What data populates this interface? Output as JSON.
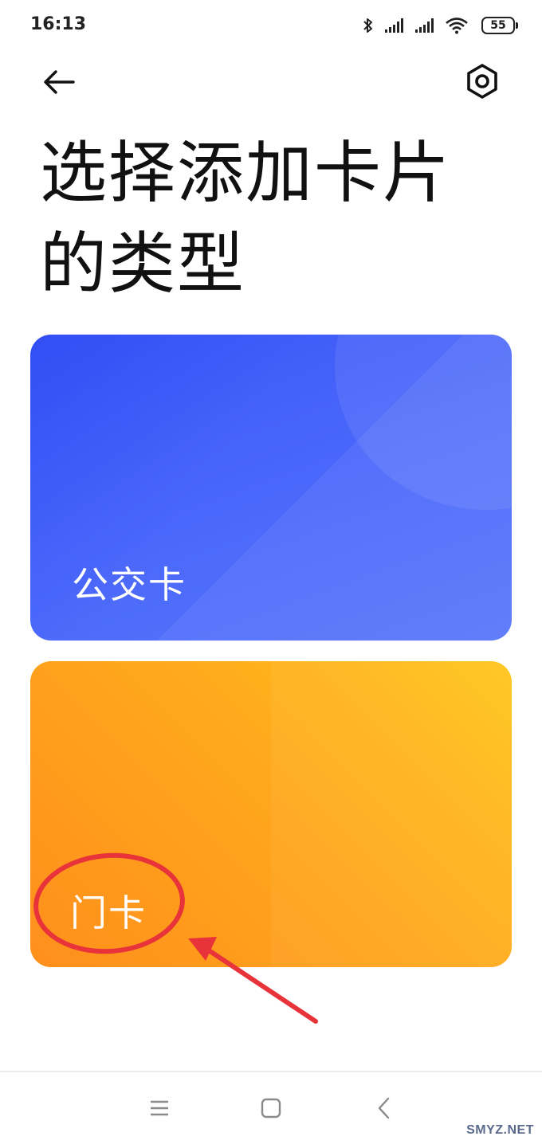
{
  "status_bar": {
    "time": "16:13",
    "battery": "55",
    "icons": [
      "bluetooth-icon",
      "signal-icon",
      "signal-icon",
      "wifi-icon",
      "battery-icon"
    ]
  },
  "header": {
    "back_icon": "arrow-left-icon",
    "settings_icon": "hexagon-gear-icon"
  },
  "page": {
    "title": "选择添加卡片的类型"
  },
  "cards": [
    {
      "label": "公交卡",
      "color": "#4a67fb"
    },
    {
      "label": "门卡",
      "color": "#ffa81c"
    }
  ],
  "annotation": {
    "color": "#e8333a"
  },
  "nav_bar": {
    "icons": [
      "menu-icon",
      "home-icon",
      "back-icon"
    ]
  },
  "watermark": "SMYZ.NET"
}
